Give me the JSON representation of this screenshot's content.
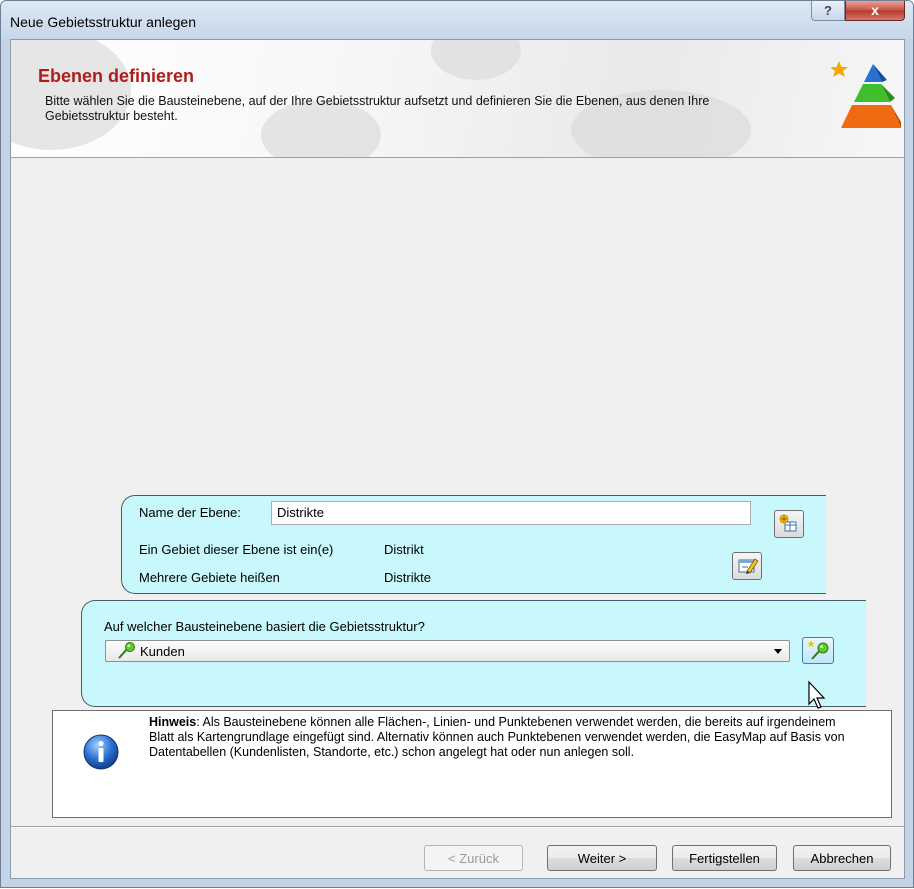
{
  "window": {
    "title": "Neue Gebietsstruktur anlegen",
    "help_label": "?",
    "close_label": "x"
  },
  "header": {
    "title": "Ebenen definieren",
    "description": "Bitte wählen Sie die Bausteinebene, auf der Ihre Gebietsstruktur aufsetzt und definieren Sie die Ebenen, aus denen Ihre Gebietsstruktur besteht."
  },
  "level": {
    "name_label": "Name der Ebene:",
    "name_value": "Distrikte",
    "singular_label": "Ein Gebiet dieser Ebene ist ein(e)",
    "singular_value": "Distrikt",
    "plural_label": "Mehrere Gebiete heißen",
    "plural_value": "Distrikte"
  },
  "base": {
    "question": "Auf welcher Bausteinebene basiert die Gebietsstruktur?",
    "selected": "Kunden"
  },
  "hint": {
    "bold": "Hinweis",
    "text": ": Als Bausteinebene können alle Flächen-, Linien- und Punktebenen verwendet werden, die bereits auf irgendeinem Blatt als Kartengrundlage eingefügt sind. Alternativ können auch Punktebenen verwendet werden, die EasyMap auf Basis von Datentabellen (Kundenlisten,  Standorte, etc.) schon angelegt hat oder nun anlegen soll."
  },
  "buttons": {
    "back": "< Zurück",
    "next": "Weiter >",
    "finish": "Fertigstellen",
    "cancel": "Abbrechen"
  },
  "colors": {
    "header_title": "#b01d1d",
    "panel_bg": "#c8f8fb",
    "dialog_bg": "#f0f0f0"
  },
  "icons": {
    "add_level": "add-level-icon",
    "edit_names": "edit-names-icon",
    "layer": "pin-layer-icon",
    "new_layer": "new-layer-icon",
    "info": "info-icon",
    "logo": "pyramid-logo-icon"
  }
}
